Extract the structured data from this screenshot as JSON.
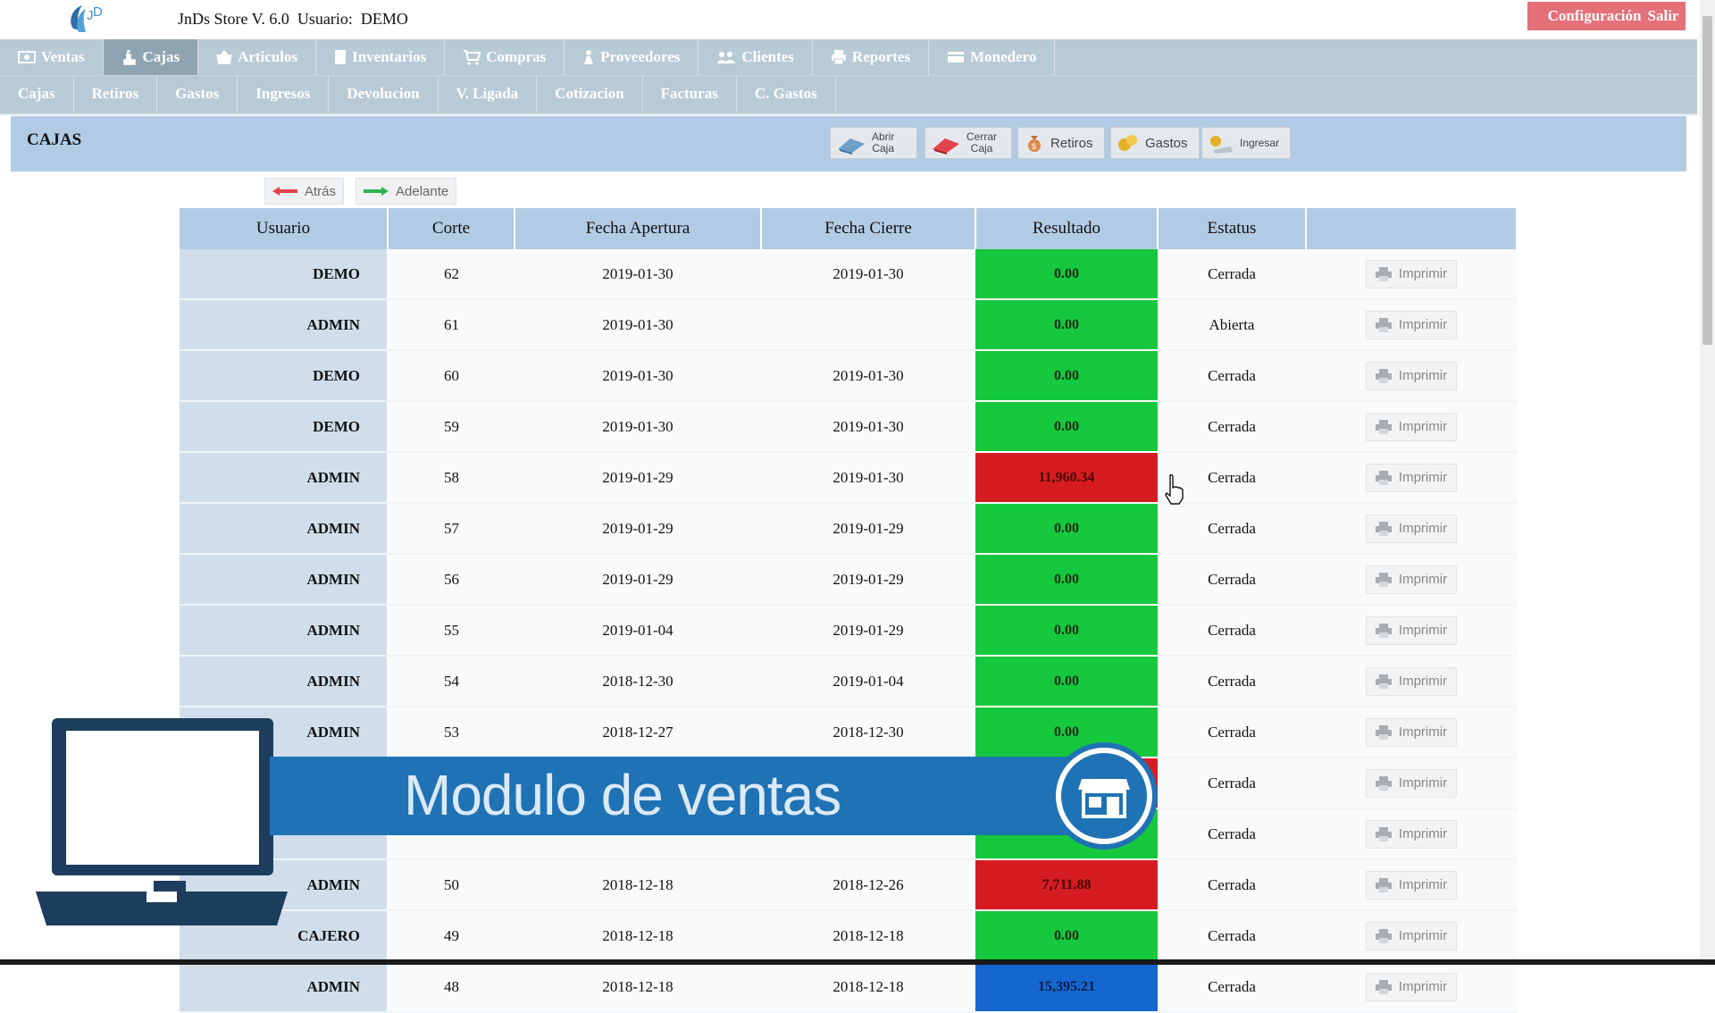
{
  "app": {
    "title": "JnDs Store V. 6.0",
    "user_label": "Usuario:",
    "user_name": "DEMO",
    "config_label": "Configuración",
    "logout_label": "Salir"
  },
  "main_nav": [
    {
      "label": "Ventas",
      "icon": "ticket-icon"
    },
    {
      "label": "Cajas",
      "icon": "cash-register-icon"
    },
    {
      "label": "Articulos",
      "icon": "basket-icon"
    },
    {
      "label": "Inventarios",
      "icon": "document-icon"
    },
    {
      "label": "Compras",
      "icon": "cart-icon"
    },
    {
      "label": "Proveedores",
      "icon": "person-icon"
    },
    {
      "label": "Clientes",
      "icon": "users-icon"
    },
    {
      "label": "Reportes",
      "icon": "printer-icon"
    },
    {
      "label": "Monedero",
      "icon": "wallet-icon"
    }
  ],
  "active_main": "Cajas",
  "sub_nav": [
    "Cajas",
    "Retiros",
    "Gastos",
    "Ingresos",
    "Devolucion",
    "V. Ligada",
    "Cotizacion",
    "Facturas",
    "C. Gastos"
  ],
  "panel": {
    "title": "CAJAS",
    "toolbar": {
      "open_line1": "Abrir",
      "open_line2": "Caja",
      "close_line1": "Cerrar",
      "close_line2": "Caja",
      "retiros": "Retiros",
      "gastos": "Gastos",
      "ingresar": "Ingresar"
    },
    "back_label": "Atrás",
    "forward_label": "Adelante"
  },
  "table": {
    "headers": [
      "Usuario",
      "Corte",
      "Fecha Apertura",
      "Fecha Cierre",
      "Resultado",
      "Estatus",
      ""
    ],
    "print_label": "Imprimir",
    "rows": [
      {
        "usuario": "DEMO",
        "corte": "62",
        "apertura": "2019-01-30",
        "cierre": "2019-01-30",
        "resultado": "0.00",
        "tone": "green",
        "estatus": "Cerrada"
      },
      {
        "usuario": "ADMIN",
        "corte": "61",
        "apertura": "2019-01-30",
        "cierre": "",
        "resultado": "0.00",
        "tone": "green",
        "estatus": "Abierta"
      },
      {
        "usuario": "DEMO",
        "corte": "60",
        "apertura": "2019-01-30",
        "cierre": "2019-01-30",
        "resultado": "0.00",
        "tone": "green",
        "estatus": "Cerrada"
      },
      {
        "usuario": "DEMO",
        "corte": "59",
        "apertura": "2019-01-30",
        "cierre": "2019-01-30",
        "resultado": "0.00",
        "tone": "green",
        "estatus": "Cerrada"
      },
      {
        "usuario": "ADMIN",
        "corte": "58",
        "apertura": "2019-01-29",
        "cierre": "2019-01-30",
        "resultado": "11,960.34",
        "tone": "red",
        "estatus": "Cerrada"
      },
      {
        "usuario": "ADMIN",
        "corte": "57",
        "apertura": "2019-01-29",
        "cierre": "2019-01-29",
        "resultado": "0.00",
        "tone": "green",
        "estatus": "Cerrada"
      },
      {
        "usuario": "ADMIN",
        "corte": "56",
        "apertura": "2019-01-29",
        "cierre": "2019-01-29",
        "resultado": "0.00",
        "tone": "green",
        "estatus": "Cerrada"
      },
      {
        "usuario": "ADMIN",
        "corte": "55",
        "apertura": "2019-01-04",
        "cierre": "2019-01-29",
        "resultado": "0.00",
        "tone": "green",
        "estatus": "Cerrada"
      },
      {
        "usuario": "ADMIN",
        "corte": "54",
        "apertura": "2018-12-30",
        "cierre": "2019-01-04",
        "resultado": "0.00",
        "tone": "green",
        "estatus": "Cerrada"
      },
      {
        "usuario": "ADMIN",
        "corte": "53",
        "apertura": "2018-12-27",
        "cierre": "2018-12-30",
        "resultado": "0.00",
        "tone": "green",
        "estatus": "Cerrada"
      },
      {
        "usuario": "",
        "corte": "",
        "apertura": "",
        "cierre": "",
        "resultado": "",
        "tone": "red",
        "estatus": "Cerrada"
      },
      {
        "usuario": "",
        "corte": "",
        "apertura": "",
        "cierre": "",
        "resultado": "",
        "tone": "green",
        "estatus": "Cerrada"
      },
      {
        "usuario": "ADMIN",
        "corte": "50",
        "apertura": "2018-12-18",
        "cierre": "2018-12-26",
        "resultado": "7,711.88",
        "tone": "red",
        "estatus": "Cerrada"
      },
      {
        "usuario": "CAJERO",
        "corte": "49",
        "apertura": "2018-12-18",
        "cierre": "2018-12-18",
        "resultado": "0.00",
        "tone": "green",
        "estatus": "Cerrada"
      },
      {
        "usuario": "ADMIN",
        "corte": "48",
        "apertura": "2018-12-18",
        "cierre": "2018-12-18",
        "resultado": "15,395.21",
        "tone": "blue",
        "estatus": "Cerrada"
      }
    ]
  },
  "overlay": {
    "banner_text": "Modulo de ventas",
    "badge_icon": "storefront-icon",
    "laptop_icon": "laptop-icon"
  },
  "colors": {
    "nav_bg": "#b9cad7",
    "panel_bg": "#b1cbe4",
    "result_green": "#16c83d",
    "result_red": "#d51d21",
    "result_blue": "#1566cf",
    "top_button": "#e4707a",
    "banner": "#1f72b4"
  }
}
